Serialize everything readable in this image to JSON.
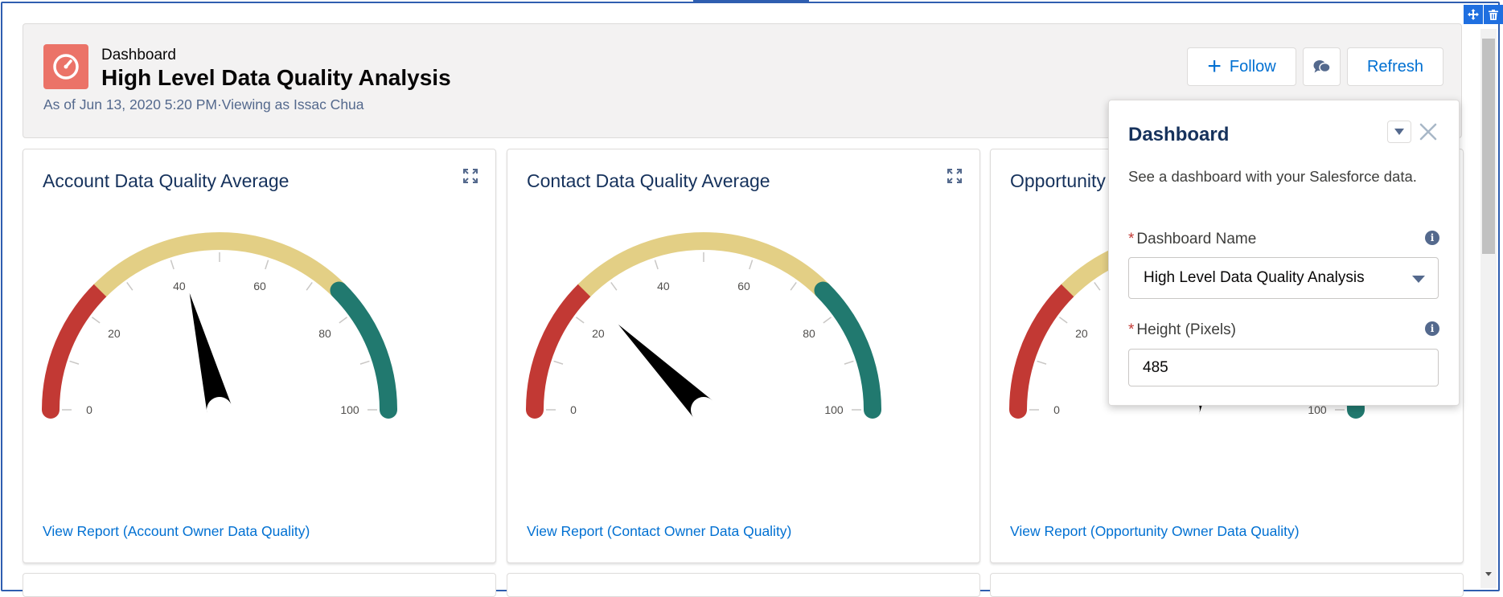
{
  "header": {
    "eyebrow": "Dashboard",
    "title": "High Level Data Quality Analysis",
    "meta": "As of Jun 13, 2020 5:20 PM·Viewing as Issac Chua",
    "follow_label": "Follow",
    "refresh_label": "Refresh"
  },
  "widgets": [
    {
      "title": "Account Data Quality Average",
      "report_link": "View Report (Account Owner Data Quality)",
      "needle_value": 42
    },
    {
      "title": "Contact Data Quality Average",
      "report_link": "View Report (Contact Owner Data Quality)",
      "needle_value": 25
    },
    {
      "title": "Opportunity",
      "report_link": "View Report (Opportunity Owner Data Quality)",
      "needle_value": 64
    }
  ],
  "gauge_ticks": [
    "0",
    "20",
    "40",
    "60",
    "80",
    "100"
  ],
  "gauge_ranges": [
    {
      "from": 0,
      "to": 25,
      "color": "#c23934"
    },
    {
      "from": 25,
      "to": 75,
      "color": "#e3cf85"
    },
    {
      "from": 75,
      "to": 100,
      "color": "#21796f"
    }
  ],
  "panel": {
    "title": "Dashboard",
    "description": "See a dashboard with your Salesforce data.",
    "name_label": "Dashboard Name",
    "name_value": "High Level Data Quality Analysis",
    "height_label": "Height (Pixels)",
    "height_value": "485",
    "required_mark": "*"
  },
  "colors": {
    "accent": "#0070d2",
    "frame": "#2f5eb0",
    "dashboard_icon": "#eb7368",
    "needle": "#000000"
  }
}
